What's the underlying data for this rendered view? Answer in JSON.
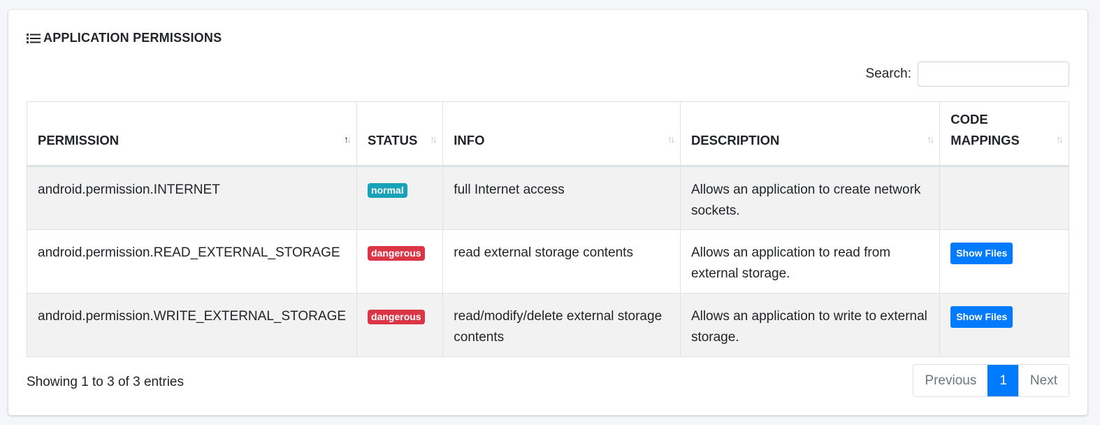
{
  "card": {
    "title": "APPLICATION PERMISSIONS",
    "icon": "list-icon"
  },
  "search": {
    "label": "Search:",
    "value": "",
    "placeholder": ""
  },
  "table": {
    "columns": [
      "PERMISSION",
      "STATUS",
      "INFO",
      "DESCRIPTION",
      "CODE MAPPINGS"
    ],
    "rows": [
      {
        "permission": "android.permission.INTERNET",
        "status": "normal",
        "info": "full Internet access",
        "description": "Allows an application to create network sockets.",
        "code_mappings": ""
      },
      {
        "permission": "android.permission.READ_EXTERNAL_STORAGE",
        "status": "dangerous",
        "info": "read external storage contents",
        "description": "Allows an application to read from external storage.",
        "code_mappings": "Show Files"
      },
      {
        "permission": "android.permission.WRITE_EXTERNAL_STORAGE",
        "status": "dangerous",
        "info": "read/modify/delete external storage contents",
        "description": "Allows an application to write to external storage.",
        "code_mappings": "Show Files"
      }
    ]
  },
  "footer": {
    "info": "Showing 1 to 3 of 3 entries",
    "previous": "Previous",
    "page": "1",
    "next": "Next"
  },
  "colors": {
    "normal_badge": "#17a2b8",
    "dangerous_badge": "#dc3545",
    "primary": "#007bff"
  }
}
